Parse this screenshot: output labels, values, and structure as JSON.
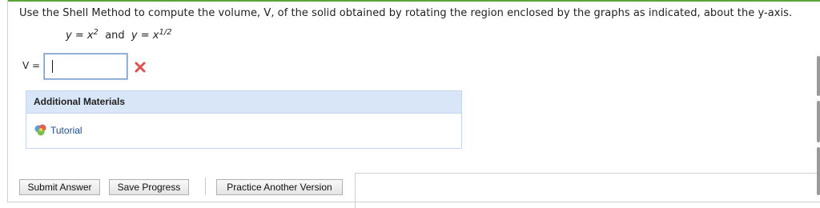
{
  "question": {
    "text": "Use the Shell Method to compute the volume, V, of the solid obtained by rotating the region enclosed by the graphs as indicated, about the y-axis."
  },
  "equations": {
    "eq1_lhs": "y = x",
    "eq1_exp": "2",
    "connector": "and",
    "eq2_lhs": "y = x",
    "eq2_exp": "1/2"
  },
  "answer": {
    "label": "V =",
    "value": "",
    "status_icon": "x-icon",
    "status_color": "#e05050"
  },
  "materials": {
    "header": "Additional Materials",
    "items": [
      {
        "label": "Tutorial",
        "icon": "tutorial-icon"
      }
    ]
  },
  "buttons": {
    "submit": "Submit Answer",
    "save": "Save Progress",
    "practice": "Practice Another Version"
  },
  "colors": {
    "accent_green": "#5aa53a",
    "panel_header": "#d9e6f7",
    "link": "#1a4e9a"
  }
}
